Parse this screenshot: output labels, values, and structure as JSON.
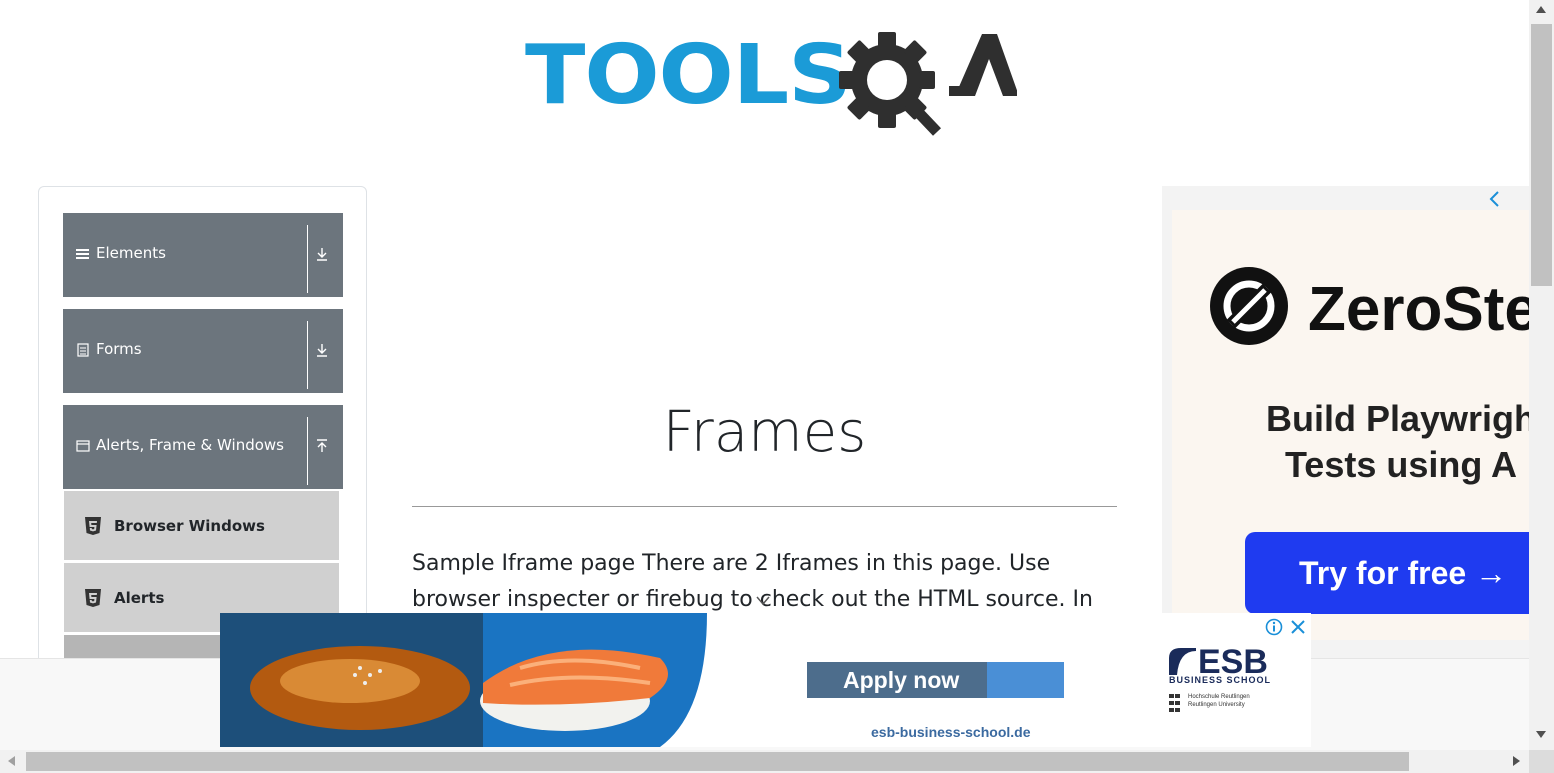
{
  "header": {
    "logo_tools": "TOOLS",
    "logo_qa": "QA",
    "colors": {
      "tools": "#1b9bd7",
      "qa": "#2f2f2f"
    }
  },
  "sidebar": {
    "groups": [
      {
        "label": "Elements",
        "icon": "hamburger-icon",
        "arrow": "download-icon"
      },
      {
        "label": "Forms",
        "icon": "document-icon",
        "arrow": "download-icon"
      },
      {
        "label": "Alerts, Frame & Windows",
        "icon": "window-icon",
        "arrow": "upload-icon"
      }
    ],
    "items": [
      {
        "label": "Browser Windows",
        "icon": "html5-icon"
      },
      {
        "label": "Alerts",
        "icon": "html5-icon"
      }
    ],
    "colors": {
      "group_bg": "#6c757d",
      "item_bg": "#d0d0d0"
    }
  },
  "main": {
    "title": "Frames",
    "description": "Sample Iframe page There are 2 Iframes in this page. Use browser inspecter or firebug to check out the HTML source. In total you"
  },
  "right_ad": {
    "brand": "ZeroSte",
    "headline_1": "Build Playwrigh",
    "headline_2": "Tests using A",
    "cta": "Try for free →",
    "colors": {
      "cta_bg": "#1f3bf0"
    }
  },
  "bottom_ad": {
    "cta": "Apply now",
    "url": "esb-business-school.de",
    "brand": "ESB",
    "brand_sub": "BUSINESS SCHOOL",
    "university_line_1": "Hochschule Reutlingen",
    "university_line_2": "Reutlingen University",
    "colors": {
      "cta_bg": "#4d6d8c",
      "brand": "#1a2b5a"
    }
  }
}
